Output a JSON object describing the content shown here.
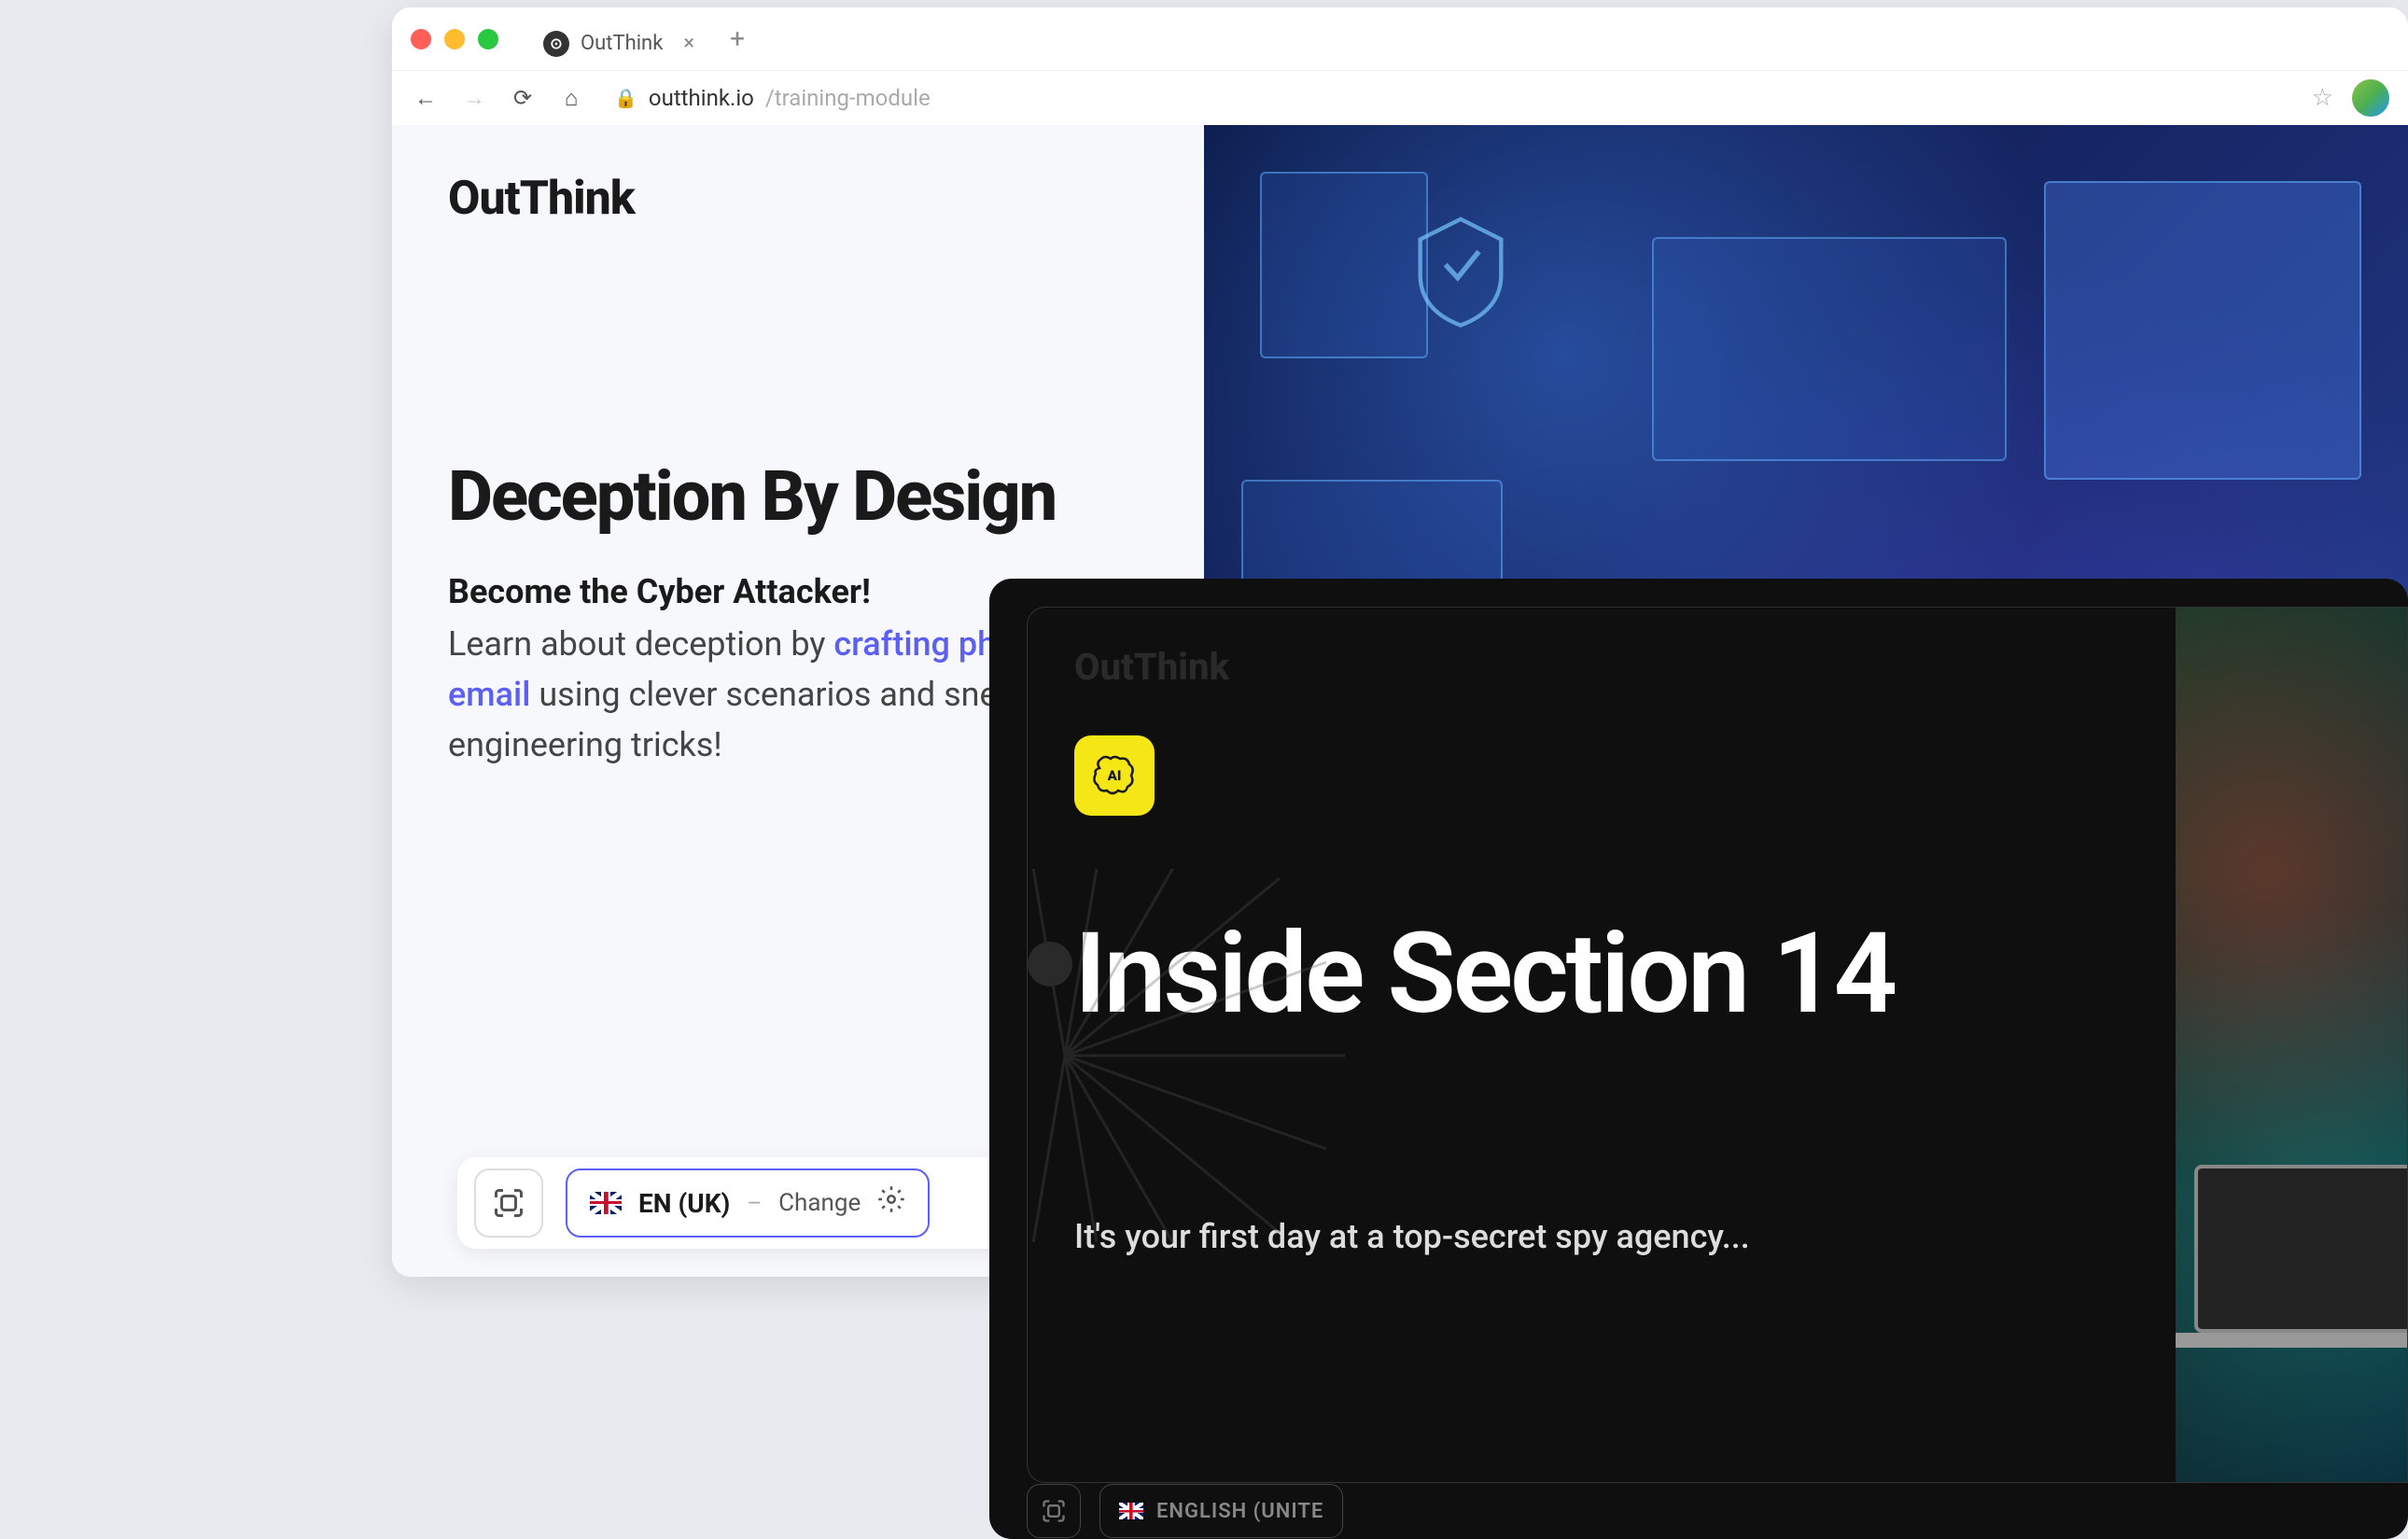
{
  "browser": {
    "tab_title": "OutThink",
    "url_domain": "outthink.io",
    "url_path": "/training-module"
  },
  "page1": {
    "brand": "OutThink",
    "title": "Deception By Design",
    "subtitle_bold": "Become the Cyber Attacker!",
    "body_prefix": "Learn about deception by ",
    "link1": "crafting",
    "body_mid1": " ",
    "link2": "phishing email",
    "body_suffix": " using clever scenarios and sneaky social engineering tricks!"
  },
  "toolbar": {
    "lang_label": "EN (UK)",
    "change_label": "Change"
  },
  "page2": {
    "brand": "OutThink",
    "ai_label": "AI",
    "title": "Inside Section 14",
    "subtitle": "It's your first day at a top-secret spy agency...",
    "lang_label": "ENGLISH (UNITE"
  }
}
